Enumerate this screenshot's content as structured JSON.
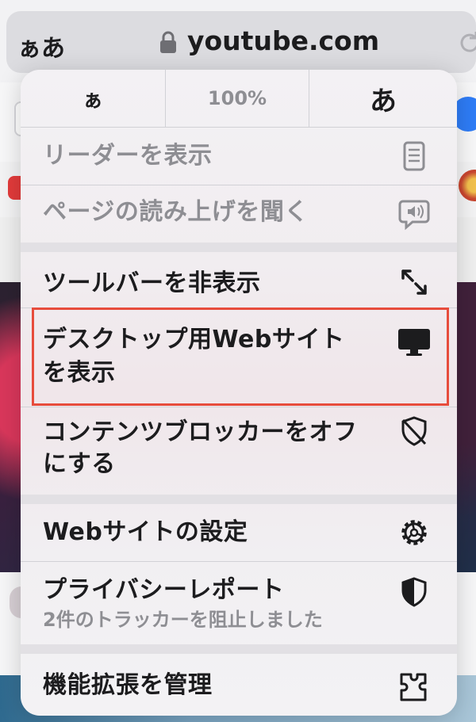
{
  "browser": {
    "aa_label": "ぁあ",
    "url": "youtube.com",
    "icons": {
      "lock": "lock-icon",
      "reload": "reload-icon"
    }
  },
  "menu": {
    "zoom": {
      "decrease": "ぁ",
      "level": "100%",
      "increase": "あ"
    },
    "items": [
      {
        "label": "リーダーを表示",
        "icon": "reader-icon",
        "enabled": false
      },
      {
        "label": "ページの読み上げを聞く",
        "icon": "speech-bubble-speaker-icon",
        "enabled": false
      },
      {
        "label": "ツールバーを非表示",
        "icon": "expand-arrows-icon",
        "enabled": true
      },
      {
        "label_line1": "デスクトップ用Webサイト",
        "label_line2": "を表示",
        "icon": "desktop-icon",
        "enabled": true,
        "highlighted": true
      },
      {
        "label_line1": "コンテンツブロッカーをオフ",
        "label_line2": "にする",
        "icon": "shield-slash-icon",
        "enabled": true
      },
      {
        "label": "Webサイトの設定",
        "icon": "gear-icon",
        "enabled": true
      },
      {
        "label": "プライバシーレポート",
        "sub": "2件のトラッカーを阻止しました",
        "icon": "privacy-shield-icon",
        "enabled": true
      },
      {
        "label": "機能拡張を管理",
        "icon": "extension-puzzle-icon",
        "enabled": true
      }
    ],
    "highlight_color": "#e74c3c"
  }
}
